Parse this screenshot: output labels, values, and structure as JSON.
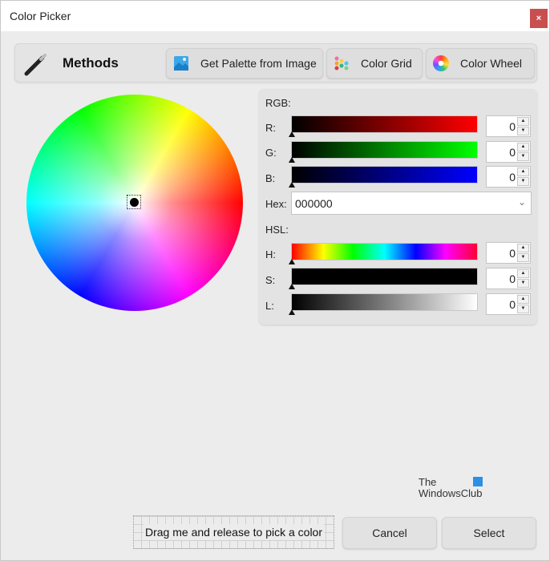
{
  "window": {
    "title": "Color Picker",
    "close_label": "×"
  },
  "methods": {
    "label": "Methods",
    "icon": "eyedropper-icon",
    "buttons": [
      {
        "label": "Get Palette from Image",
        "icon": "image-icon"
      },
      {
        "label": "Color Grid",
        "icon": "color-grid-icon"
      },
      {
        "label": "Color Wheel",
        "icon": "color-wheel-icon"
      }
    ]
  },
  "wheel": {
    "selected_hue": 0,
    "selected_saturation": 0
  },
  "rgb": {
    "label": "RGB:",
    "channels": [
      {
        "label": "R:",
        "value": "0",
        "fraction": 0,
        "color": "#ff0000"
      },
      {
        "label": "G:",
        "value": "0",
        "fraction": 0,
        "color": "#00ff00"
      },
      {
        "label": "B:",
        "value": "0",
        "fraction": 0,
        "color": "#0000ff"
      }
    ],
    "hex_label": "Hex:",
    "hex_value": "000000"
  },
  "hsl": {
    "label": "HSL:",
    "channels": [
      {
        "label": "H:",
        "value": "0",
        "fraction": 0
      },
      {
        "label": "S:",
        "value": "0",
        "fraction": 0
      },
      {
        "label": "L:",
        "value": "0",
        "fraction": 0
      }
    ]
  },
  "watermark": {
    "line1": "The",
    "line2": "WindowsClub"
  },
  "footer": {
    "drag_label": "Drag me and release to pick a color",
    "cancel_label": "Cancel",
    "select_label": "Select"
  },
  "colors": {
    "close_button": "#c94f4f",
    "current_color": "#000000"
  }
}
